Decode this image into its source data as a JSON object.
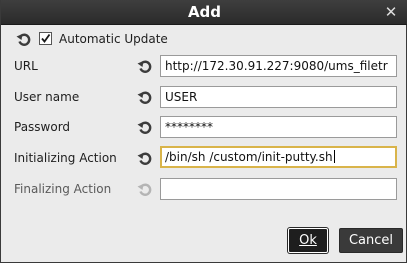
{
  "dialog": {
    "title": "Add",
    "close_glyph": "✕"
  },
  "automatic_update": {
    "label": "Automatic Update",
    "checked": true
  },
  "fields": {
    "url": {
      "label": "URL",
      "value": "http://172.30.91.227:9080/ums_filetr"
    },
    "username": {
      "label": "User name",
      "value": "USER"
    },
    "password": {
      "label": "Password",
      "value": "********"
    },
    "init_action": {
      "label": "Initializing Action",
      "value": "/bin/sh /custom/init-putty.sh"
    },
    "final_action": {
      "label": "Finalizing Action",
      "value": ""
    }
  },
  "buttons": {
    "ok_label": "Ok",
    "cancel_label": "Cancel"
  },
  "icons": {
    "reset": "reset-arrow-icon",
    "check": "checkmark-icon"
  },
  "colors": {
    "titlebar": "#2f2f2f",
    "background": "#ebebeb",
    "focus_border": "#d9b44a"
  }
}
